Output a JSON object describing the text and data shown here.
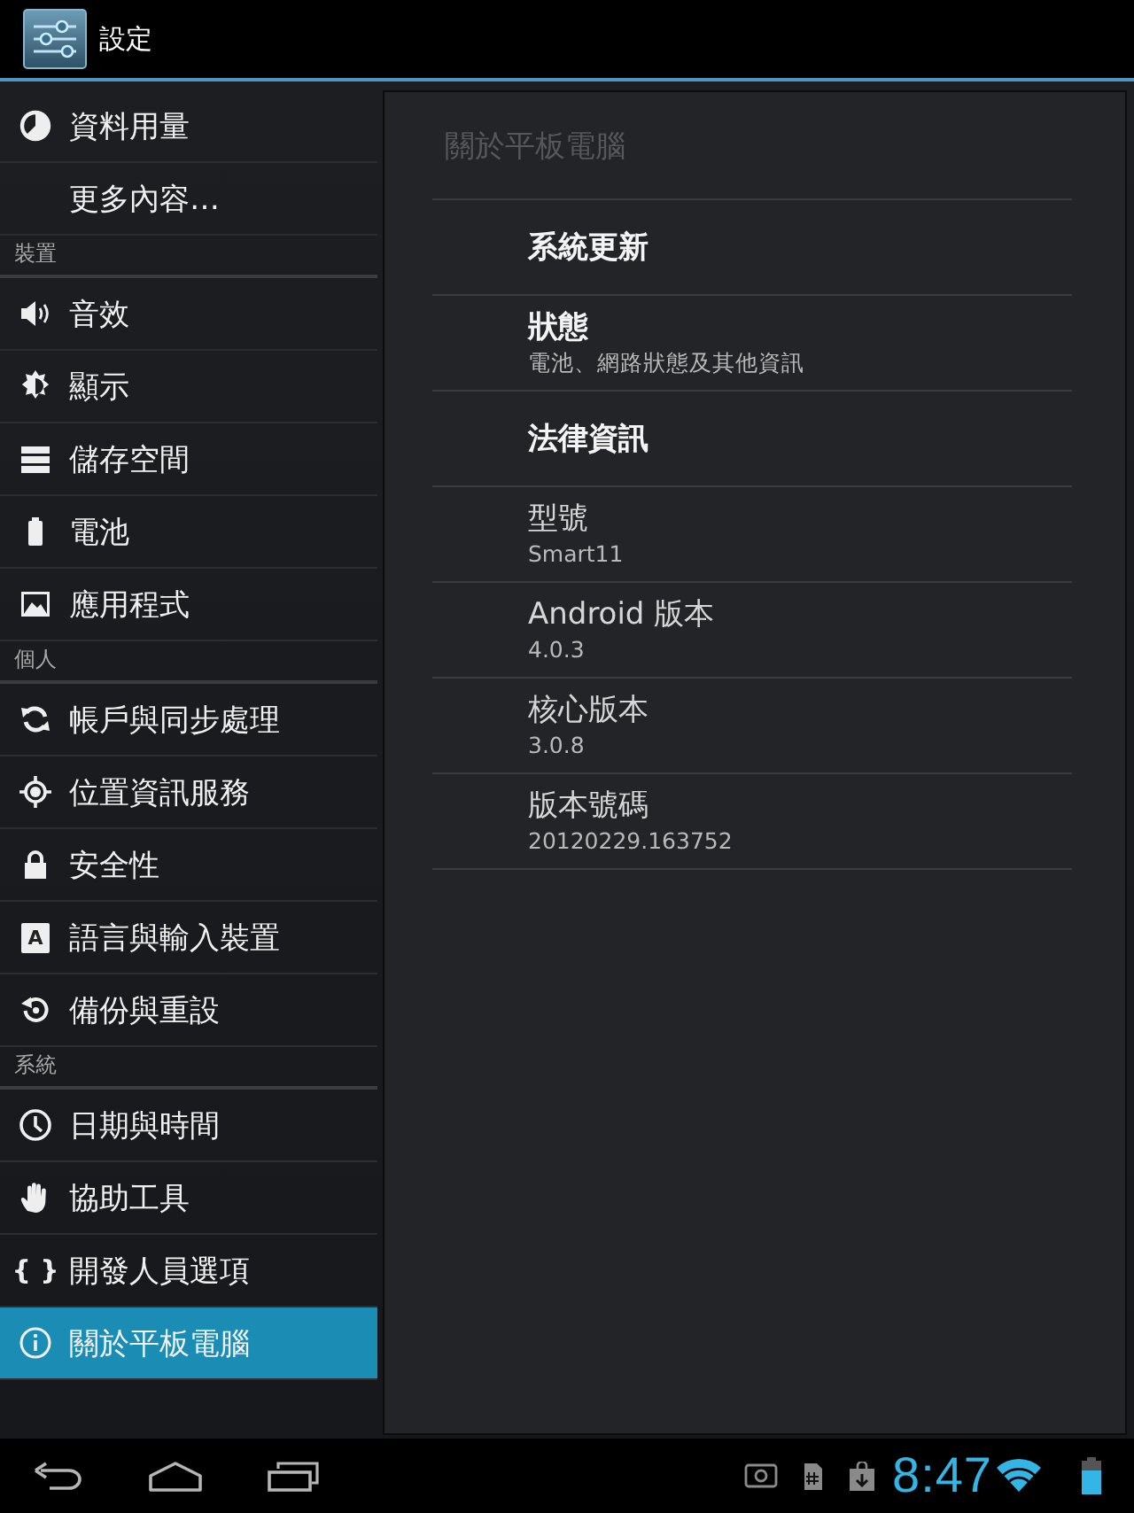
{
  "action_bar": {
    "title": "設定"
  },
  "sidebar": {
    "items": [
      {
        "kind": "item",
        "label": "資料用量",
        "selected": false
      },
      {
        "kind": "item",
        "label": "更多內容…",
        "selected": false
      },
      {
        "kind": "header",
        "label": "裝置"
      },
      {
        "kind": "item",
        "label": "音效",
        "selected": false
      },
      {
        "kind": "item",
        "label": "顯示",
        "selected": false
      },
      {
        "kind": "item",
        "label": "儲存空間",
        "selected": false
      },
      {
        "kind": "item",
        "label": "電池",
        "selected": false
      },
      {
        "kind": "item",
        "label": "應用程式",
        "selected": false
      },
      {
        "kind": "header",
        "label": "個人"
      },
      {
        "kind": "item",
        "label": "帳戶與同步處理",
        "selected": false
      },
      {
        "kind": "item",
        "label": "位置資訊服務",
        "selected": false
      },
      {
        "kind": "item",
        "label": "安全性",
        "selected": false
      },
      {
        "kind": "item",
        "label": "語言與輸入裝置",
        "selected": false,
        "icon_text": "A"
      },
      {
        "kind": "item",
        "label": "備份與重設",
        "selected": false
      },
      {
        "kind": "header",
        "label": "系統"
      },
      {
        "kind": "item",
        "label": "日期與時間",
        "selected": false
      },
      {
        "kind": "item",
        "label": "協助工具",
        "selected": false
      },
      {
        "kind": "item",
        "label": "開發人員選項",
        "selected": false,
        "icon_text": "{ }"
      },
      {
        "kind": "item",
        "label": "關於平板電腦",
        "selected": true
      }
    ]
  },
  "detail": {
    "title": "關於平板電腦",
    "items": [
      {
        "kind": "link",
        "title": "系統更新"
      },
      {
        "kind": "link",
        "title": "狀態",
        "summary": "電池、網路狀態及其他資訊"
      },
      {
        "kind": "link",
        "title": "法律資訊"
      },
      {
        "kind": "info",
        "title": "型號",
        "summary": "Smart11"
      },
      {
        "kind": "info",
        "title": "Android 版本",
        "summary": "4.0.3"
      },
      {
        "kind": "info",
        "title": "核心版本",
        "summary": "3.0.8"
      },
      {
        "kind": "info",
        "title": "版本號碼",
        "summary": "20120229.163752"
      }
    ]
  },
  "status_bar": {
    "clock": "8:47"
  }
}
